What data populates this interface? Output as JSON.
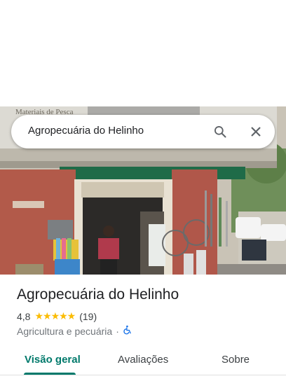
{
  "search": {
    "query": "Agropecuária do Helinho"
  },
  "photo": {
    "sign_text": "Materiais de Pesca"
  },
  "place": {
    "name": "Agropecuária do Helinho",
    "rating": "4,8",
    "stars": "★★★★★",
    "reviews_count": "(19)",
    "category": "Agricultura e pecuária",
    "separator": "·"
  },
  "tabs": [
    {
      "label": "Visão geral",
      "active": true
    },
    {
      "label": "Avaliações",
      "active": false
    },
    {
      "label": "Sobre",
      "active": false
    }
  ],
  "colors": {
    "accent": "#00796b",
    "star": "#fbbc04",
    "accessibility": "#1a73e8"
  },
  "icons": [
    "search-icon",
    "close-icon",
    "wheelchair-icon"
  ]
}
